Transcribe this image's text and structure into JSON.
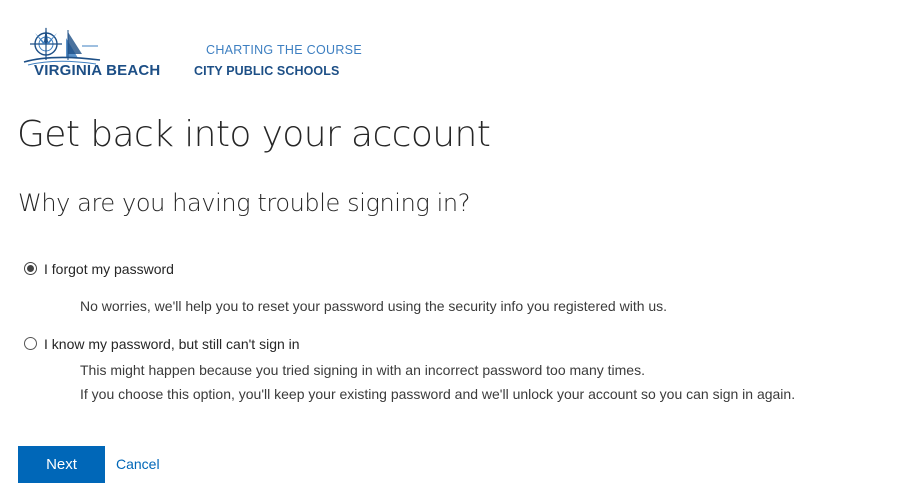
{
  "logo": {
    "brand_left": "VIRGINIA BEACH",
    "tagline": "CHARTING THE COURSE",
    "brand_right": "CITY PUBLIC SCHOOLS",
    "icon": "compass-ship-logo-icon",
    "colors": {
      "primary": "#1d4f86",
      "secondary": "#3d7fc1"
    }
  },
  "main": {
    "title": "Get back into your account",
    "subtitle": "Why are you having trouble signing in?",
    "options": [
      {
        "label": "I forgot my password",
        "selected": true,
        "description": [
          "No worries, we'll help you to reset your password using the security info you registered with us."
        ]
      },
      {
        "label": "I know my password, but still can't sign in",
        "selected": false,
        "description": [
          "This might happen because you tried signing in with an incorrect password too many times.",
          "If you choose this option, you'll keep your existing password and we'll unlock your account so you can sign in again."
        ]
      }
    ]
  },
  "actions": {
    "next_label": "Next",
    "cancel_label": "Cancel",
    "accent_color": "#0067b8"
  }
}
